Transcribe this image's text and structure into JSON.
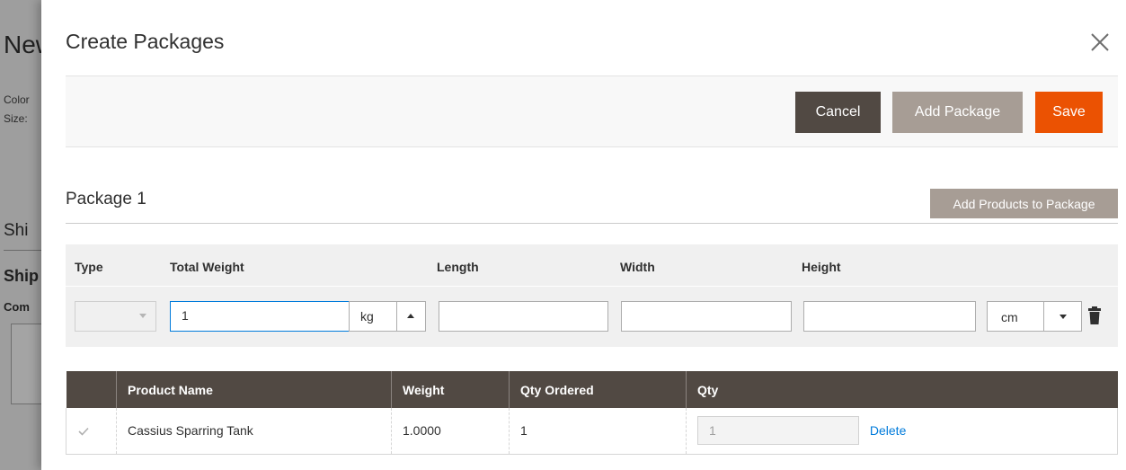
{
  "background": {
    "heading": "New",
    "color_label": "Color",
    "size_label": "Size:",
    "section1": "Shi",
    "section2": "Ship",
    "comment": "Com"
  },
  "modal": {
    "title": "Create Packages",
    "close_icon": "close-icon"
  },
  "actions": {
    "cancel": "Cancel",
    "add_package": "Add Package",
    "save": "Save"
  },
  "package": {
    "title": "Package 1",
    "add_products": "Add Products to Package",
    "headers": {
      "type": "Type",
      "total_weight": "Total Weight",
      "length": "Length",
      "width": "Width",
      "height": "Height"
    },
    "type_value": "",
    "weight_value": "1",
    "weight_unit": "kg",
    "length_value": "",
    "width_value": "",
    "height_value": "",
    "dimension_unit": "cm",
    "delete_icon": "trash-icon"
  },
  "table": {
    "columns": [
      "",
      "Product Name",
      "Weight",
      "Qty Ordered",
      "Qty"
    ],
    "rows": [
      {
        "checked": true,
        "product_name": "Cassius Sparring Tank",
        "weight": "1.0000",
        "qty_ordered": "1",
        "qty": "1",
        "delete": "Delete"
      }
    ]
  },
  "colors": {
    "primary_dark": "#514943",
    "disabled": "#a79d95",
    "accent": "#eb5202",
    "link": "#007bdb"
  }
}
